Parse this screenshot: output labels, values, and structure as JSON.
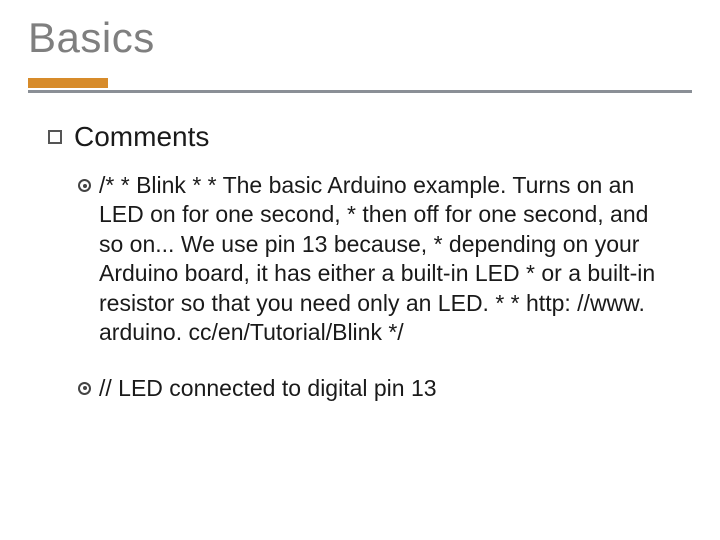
{
  "slide": {
    "title": "Basics",
    "section": {
      "heading": "Comments",
      "items": [
        "/* * Blink * * The basic Arduino example. Turns on an LED on for one second, * then off for one second, and so on... We use pin 13 because, * depending on your Arduino board, it has either a built-in LED * or a built-in resistor so that you need only an LED. * * http: //www. arduino. cc/en/Tutorial/Blink */",
        "// LED connected to digital pin 13"
      ]
    }
  }
}
